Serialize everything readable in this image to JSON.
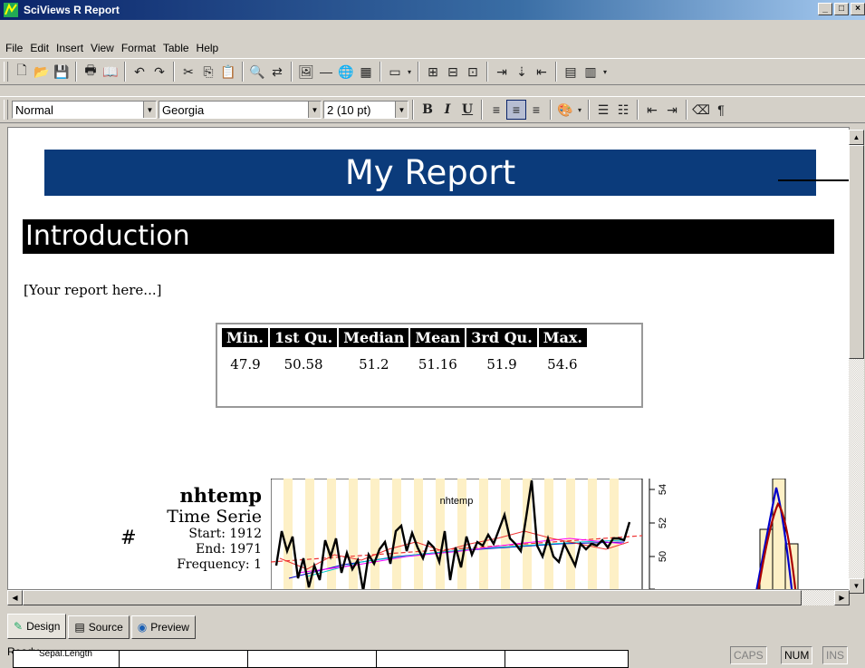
{
  "window": {
    "title": "SciViews R Report",
    "controls": [
      "_",
      "□",
      "×"
    ]
  },
  "menu": [
    "File",
    "Edit",
    "Insert",
    "View",
    "Format",
    "Table",
    "Help"
  ],
  "toolbar2": {
    "style": "Normal",
    "font": "Georgia",
    "size": "2 (10 pt)",
    "bold": "B",
    "italic": "I",
    "underline": "U",
    "pilcrow": "¶"
  },
  "doc": {
    "banner": "My Report",
    "heading": "Introduction",
    "paragraph": "[Your report here...]",
    "summary": {
      "headers": [
        "Min.",
        "1st Qu.",
        "Median",
        "Mean",
        "3rd Qu.",
        "Max."
      ],
      "values": [
        "47.9",
        "50.58",
        "51.2",
        "51.16",
        "51.9",
        "54.6"
      ]
    },
    "ts": {
      "name": "nhtemp",
      "type": "Time Serie",
      "start": "Start: 1912",
      "end": "End: 1971",
      "frequency": "Frequency: 1",
      "hash": "#",
      "plot_title": "nhtemp",
      "yticks": [
        "54",
        "52",
        "50"
      ]
    }
  },
  "tabs": [
    {
      "label": "Design"
    },
    {
      "label": "Source"
    },
    {
      "label": "Preview"
    }
  ],
  "status": {
    "text": "Ready",
    "caps": "CAPS",
    "num": "NUM",
    "ins": "INS"
  },
  "overlay": {
    "label": "Sepal.Length"
  }
}
